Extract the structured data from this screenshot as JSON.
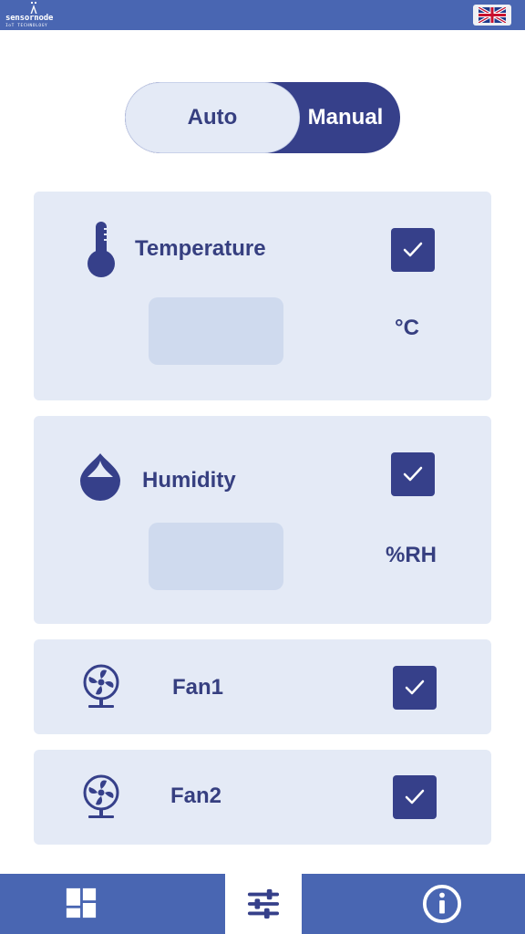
{
  "header": {
    "brand": "sensornode",
    "tagline": "IoT TECHNOLOGY",
    "language_icon": "uk-flag-icon"
  },
  "mode_toggle": {
    "auto_label": "Auto",
    "manual_label": "Manual",
    "selected": "Auto"
  },
  "sensors": {
    "temperature": {
      "label": "Temperature",
      "unit": "°C",
      "value": "",
      "checked": true,
      "icon": "thermometer-icon"
    },
    "humidity": {
      "label": "Humidity",
      "unit": "%RH",
      "value": "",
      "checked": true,
      "icon": "droplet-icon"
    }
  },
  "fans": [
    {
      "label": "Fan1",
      "checked": true,
      "icon": "fan-icon"
    },
    {
      "label": "Fan2",
      "checked": true,
      "icon": "fan-icon"
    }
  ],
  "bottom_nav": {
    "items": [
      {
        "icon": "dashboard-icon"
      },
      {
        "icon": "sliders-icon",
        "active": true
      },
      {
        "icon": "info-icon"
      }
    ]
  },
  "colors": {
    "primary": "#4966b2",
    "accent": "#36408a",
    "card": "#e4eaf6",
    "input": "#cfdaee"
  }
}
